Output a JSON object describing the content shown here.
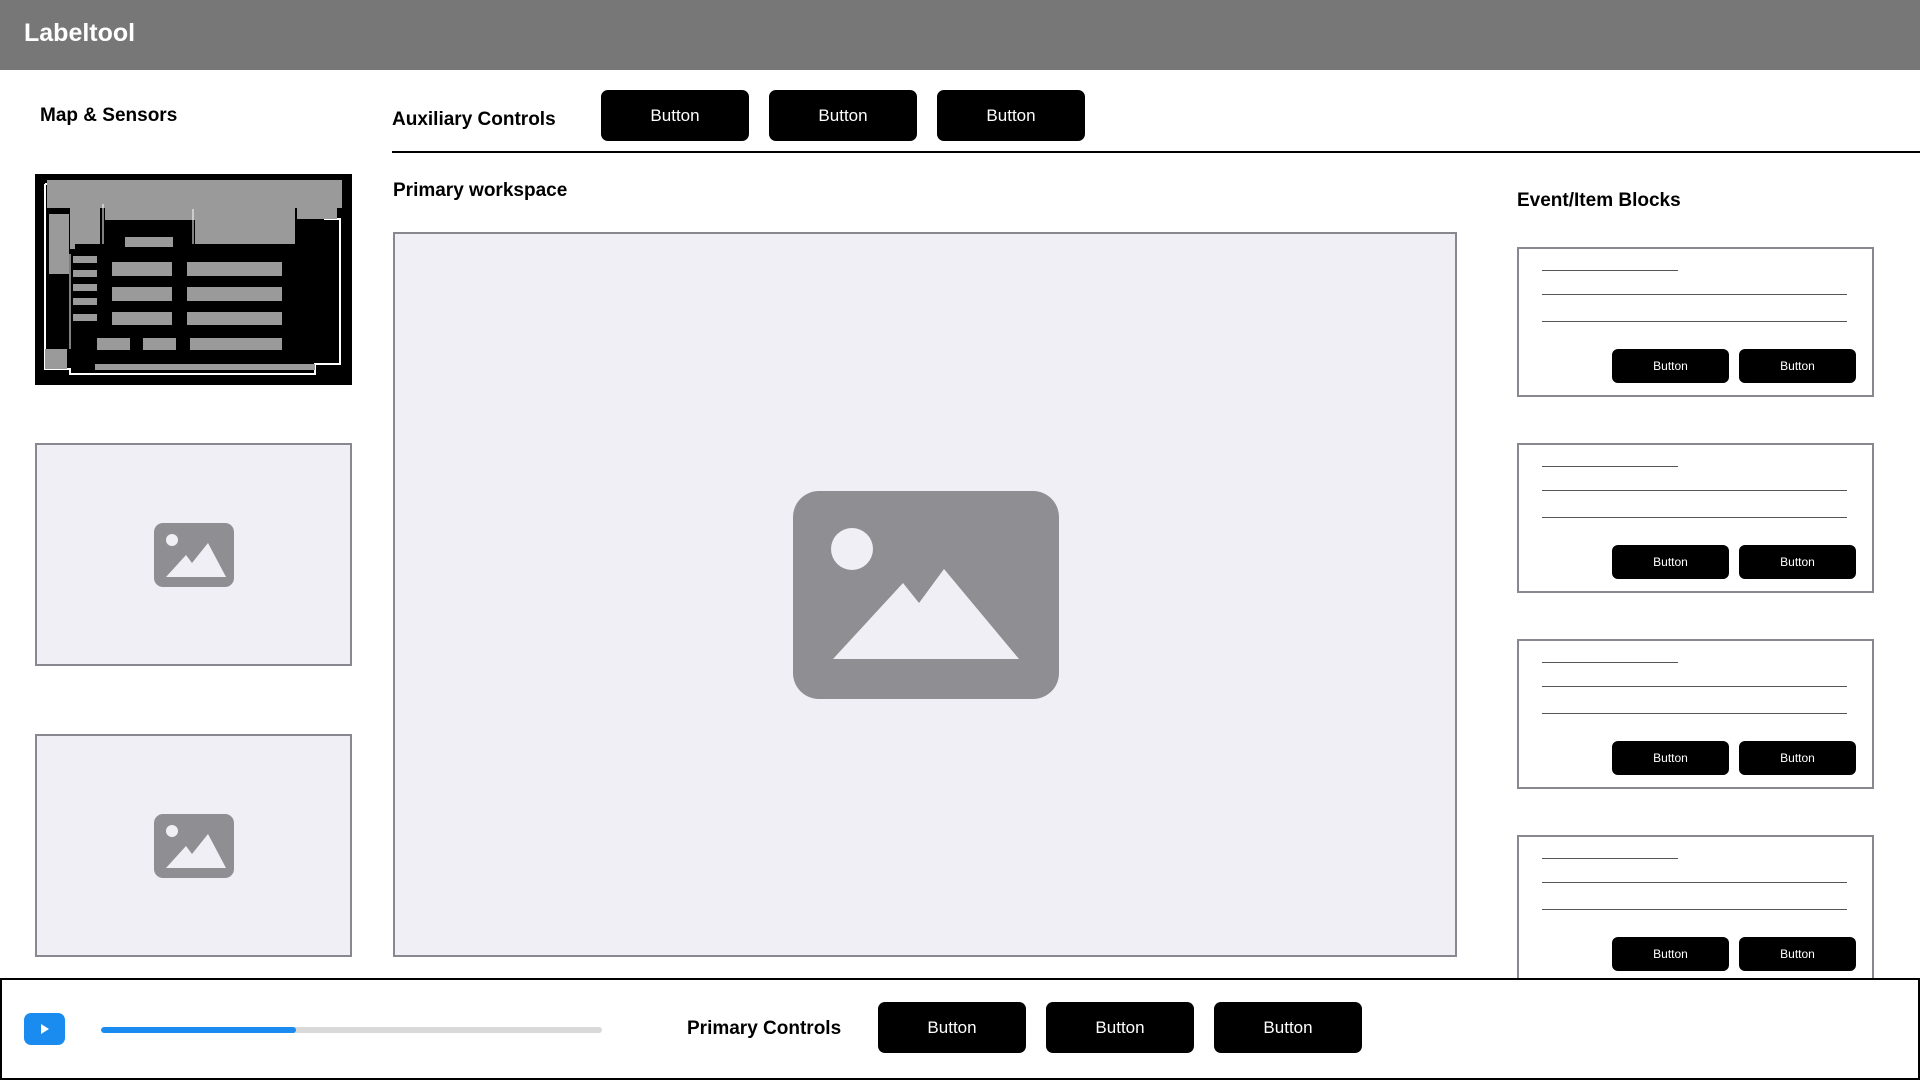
{
  "app": {
    "title": "Labeltool"
  },
  "sidebar": {
    "title": "Map & Sensors",
    "sensors": [
      {
        "icon": "image-placeholder-icon"
      },
      {
        "icon": "image-placeholder-icon"
      }
    ]
  },
  "auxiliary": {
    "title": "Auxiliary Controls",
    "buttons": [
      "Button",
      "Button",
      "Button"
    ]
  },
  "workspace": {
    "title": "Primary workspace",
    "icon": "image-placeholder-icon"
  },
  "events": {
    "title": "Event/Item Blocks",
    "blocks": [
      {
        "buttons": [
          "Button",
          "Button"
        ]
      },
      {
        "buttons": [
          "Button",
          "Button"
        ]
      },
      {
        "buttons": [
          "Button",
          "Button"
        ]
      },
      {
        "buttons": [
          "Button",
          "Button"
        ]
      }
    ]
  },
  "primary_controls": {
    "title": "Primary Controls",
    "buttons": [
      "Button",
      "Button",
      "Button"
    ],
    "play_icon": "play-icon",
    "progress": 0.39
  },
  "colors": {
    "header": "#777777",
    "accent": "#1a8cf0",
    "placeholder_bg": "#efeff5",
    "placeholder_icon": "#8e8e93",
    "button": "#000000"
  }
}
